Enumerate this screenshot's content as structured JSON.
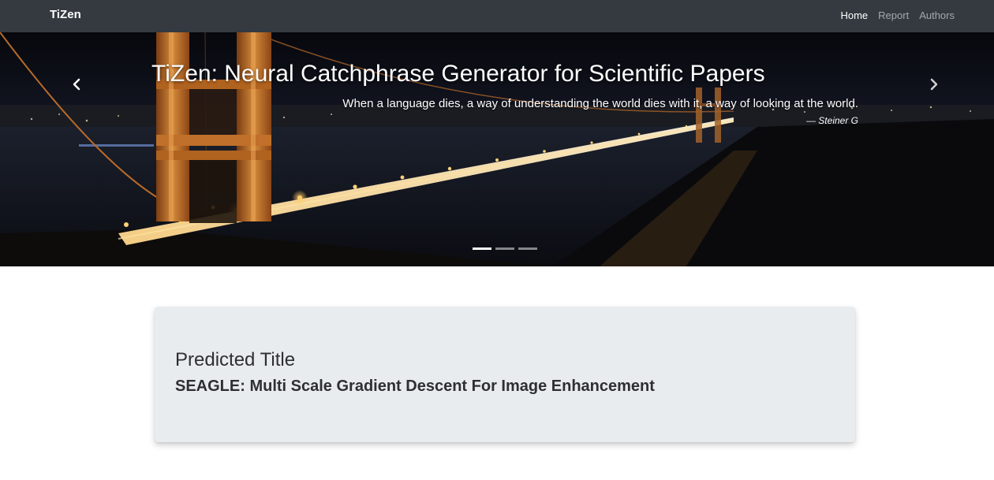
{
  "navbar": {
    "brand": "TiZen",
    "links": [
      {
        "label": "Home",
        "active": true
      },
      {
        "label": "Report",
        "active": false
      },
      {
        "label": "Authors",
        "active": false
      }
    ]
  },
  "carousel": {
    "title": "TiZen: Neural Catchphrase Generator for Scientific Papers",
    "quote": "When a language dies, a way of understanding the world dies with it, a way of looking at the world.",
    "author": "— Steiner G",
    "prev_icon": "chevron-left-icon",
    "next_icon": "chevron-right-icon",
    "slide_count": 3,
    "active_slide": 1
  },
  "result": {
    "label": "Predicted Title",
    "value": "SEAGLE: Multi Scale Gradient Descent For Image Enhancement"
  },
  "colors": {
    "navbar_bg": "#343a40",
    "card_bg": "#e9ecef",
    "bridge_orange": "#c8782a"
  }
}
